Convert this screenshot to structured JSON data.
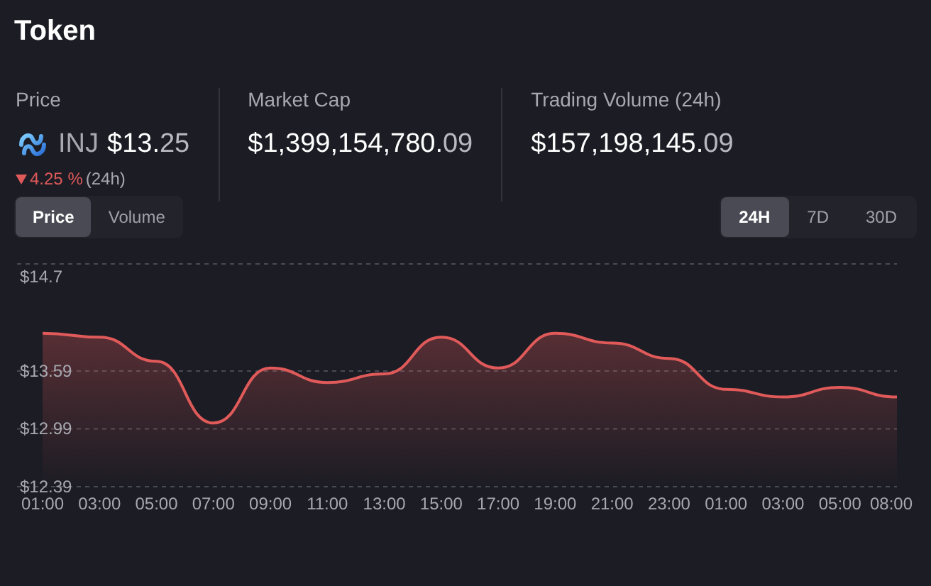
{
  "title": "Token",
  "stats": [
    {
      "kind": "price",
      "label": "Price",
      "symbol": "INJ",
      "value": "$13.25",
      "change": {
        "kind": "down",
        "value": "4.25 %",
        "period": "(24h)"
      }
    },
    {
      "kind": "plain",
      "label": "Market Cap",
      "value": "$1,399,154,780.09"
    },
    {
      "kind": "plain",
      "label": "Trading Volume (24h)",
      "value": "$157,198,145.09"
    }
  ],
  "metric_tabs": [
    {
      "label": "Price",
      "selected": true
    },
    {
      "label": "Volume",
      "selected": false
    }
  ],
  "range_tabs": [
    {
      "label": "24H",
      "selected": true
    },
    {
      "label": "7D",
      "selected": false
    },
    {
      "label": "30D",
      "selected": false
    }
  ],
  "chart_data": {
    "type": "area",
    "categories": [
      "01:00",
      "03:00",
      "05:00",
      "07:00",
      "09:00",
      "11:00",
      "13:00",
      "15:00",
      "17:00",
      "19:00",
      "21:00",
      "23:00",
      "01:00",
      "03:00",
      "05:00",
      "08:00"
    ],
    "values": [
      13.98,
      13.94,
      13.69,
      13.05,
      13.62,
      13.47,
      13.56,
      13.94,
      13.62,
      13.98,
      13.88,
      13.72,
      13.4,
      13.32,
      13.42,
      13.32
    ],
    "ylim": [
      12.39,
      14.7
    ],
    "yticks": [
      {
        "value": 14.7,
        "label": "$14.7"
      },
      {
        "value": 13.59,
        "label": "$13.59"
      },
      {
        "value": 12.99,
        "label": "$12.99"
      },
      {
        "value": 12.39,
        "label": "$12.39"
      }
    ]
  }
}
